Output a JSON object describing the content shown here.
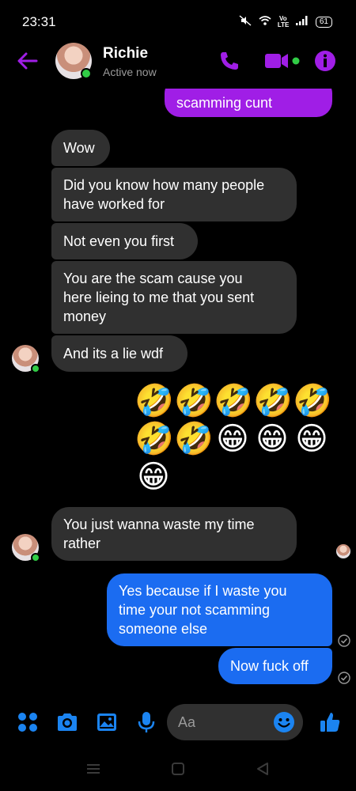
{
  "status_bar": {
    "time": "23:31",
    "network": "Vo LTE",
    "battery": "61"
  },
  "header": {
    "contact_name": "Richie",
    "contact_status": "Active now",
    "accent_color": "#a01ee6"
  },
  "messages": {
    "m0": "scamming cunt",
    "m1": "Wow",
    "m2": "Did you know how many people\nhave worked for",
    "m3": "Not even you first",
    "m4": "You are the scam cause you\nhere lieing to me that you sent\nmoney",
    "m5": "And its a lie wdf",
    "m6": "You just wanna waste my time\nrather",
    "m7": "Yes because if I waste you\ntime your not scamming\nsomeone else",
    "m8": "Now fuck off"
  },
  "emojis": [
    "🤣",
    "🤣",
    "🤣",
    "🤣",
    "🤣",
    "🤣",
    "🤣",
    "😁",
    "😁",
    "😁",
    "😁"
  ],
  "composer": {
    "placeholder": "Aa"
  },
  "colors": {
    "incoming_bubble": "#303030",
    "outgoing_purple": "#a01ee6",
    "outgoing_blue": "#1b6cf1",
    "icon_purple": "#a01ee6",
    "icon_blue": "#1b84f1",
    "online_green": "#31cc46"
  },
  "icons": {
    "back": "back-arrow-icon",
    "call": "phone-icon",
    "video": "video-camera-icon",
    "info": "info-icon",
    "menu": "four-dots-icon",
    "camera": "camera-icon",
    "gallery": "image-icon",
    "mic": "microphone-icon",
    "emoji": "smiley-icon",
    "like": "thumbs-up-icon"
  }
}
